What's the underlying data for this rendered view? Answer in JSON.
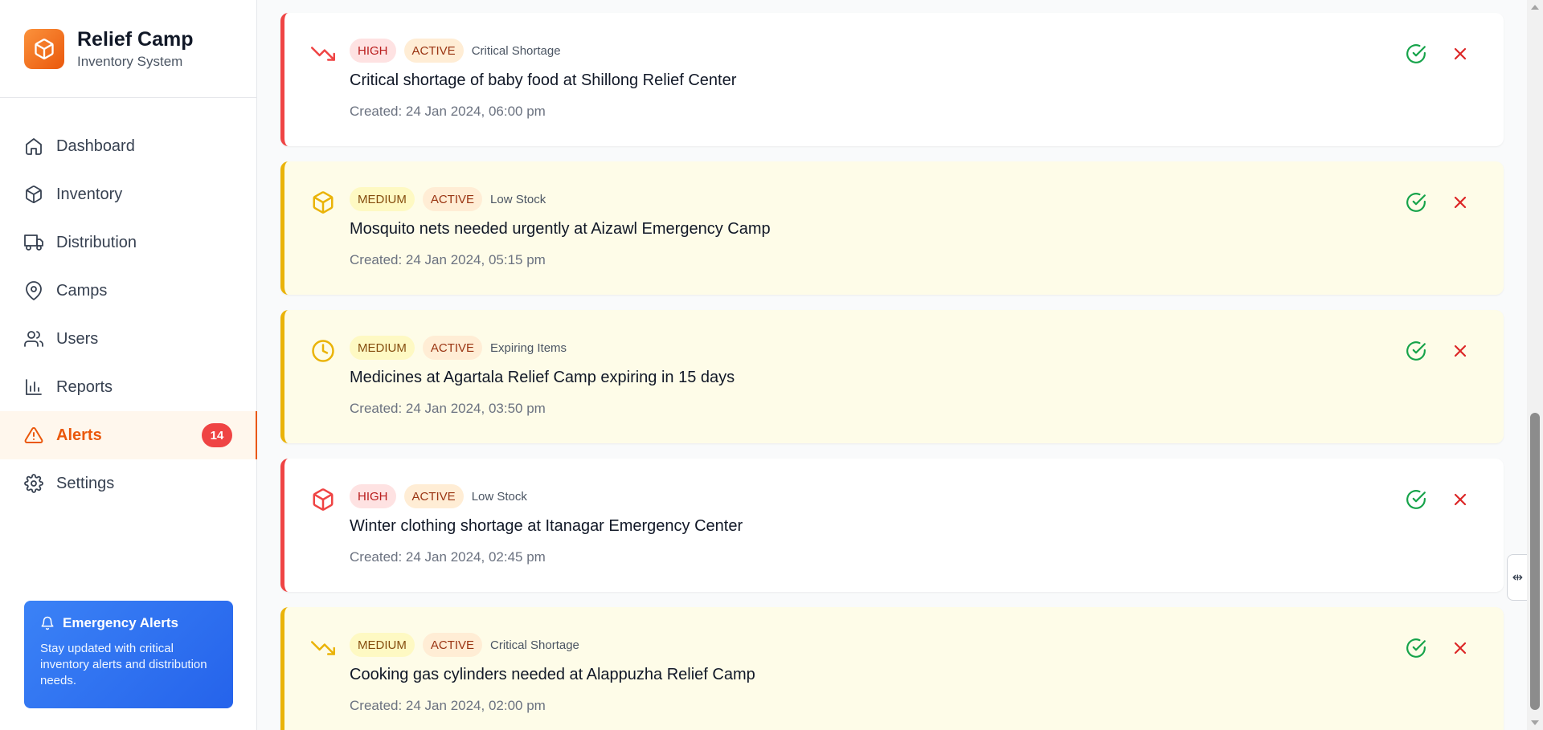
{
  "app": {
    "title": "Relief Camp",
    "subtitle": "Inventory System"
  },
  "nav": {
    "items": [
      {
        "label": "Dashboard",
        "icon": "home-icon"
      },
      {
        "label": "Inventory",
        "icon": "package-icon"
      },
      {
        "label": "Distribution",
        "icon": "truck-icon"
      },
      {
        "label": "Camps",
        "icon": "map-pin-icon"
      },
      {
        "label": "Users",
        "icon": "users-icon"
      },
      {
        "label": "Reports",
        "icon": "bar-chart-icon"
      },
      {
        "label": "Alerts",
        "icon": "alert-triangle-icon",
        "active": true,
        "badge": "14"
      },
      {
        "label": "Settings",
        "icon": "gear-icon"
      }
    ]
  },
  "emergency": {
    "title": "Emergency Alerts",
    "text": "Stay updated with critical inventory alerts and distribution needs."
  },
  "alerts": [
    {
      "severity": "HIGH",
      "status": "ACTIVE",
      "type": "Critical Shortage",
      "message": "Critical shortage of baby food at Shillong Relief Center",
      "created": "Created: 24 Jan 2024, 06:00 pm",
      "icon": "trending-down-icon"
    },
    {
      "severity": "MEDIUM",
      "status": "ACTIVE",
      "type": "Low Stock",
      "message": "Mosquito nets needed urgently at Aizawl Emergency Camp",
      "created": "Created: 24 Jan 2024, 05:15 pm",
      "icon": "package-icon"
    },
    {
      "severity": "MEDIUM",
      "status": "ACTIVE",
      "type": "Expiring Items",
      "message": "Medicines at Agartala Relief Camp expiring in 15 days",
      "created": "Created: 24 Jan 2024, 03:50 pm",
      "icon": "clock-icon"
    },
    {
      "severity": "HIGH",
      "status": "ACTIVE",
      "type": "Low Stock",
      "message": "Winter clothing shortage at Itanagar Emergency Center",
      "created": "Created: 24 Jan 2024, 02:45 pm",
      "icon": "package-icon"
    },
    {
      "severity": "MEDIUM",
      "status": "ACTIVE",
      "type": "Critical Shortage",
      "message": "Cooking gas cylinders needed at Alappuzha Relief Camp",
      "created": "Created: 24 Jan 2024, 02:00 pm",
      "icon": "trending-down-icon"
    }
  ],
  "colors": {
    "accent": "#ea580c",
    "high": "#ef4444",
    "medium": "#eab308",
    "resolve": "#16a34a",
    "dismiss": "#dc2626"
  }
}
